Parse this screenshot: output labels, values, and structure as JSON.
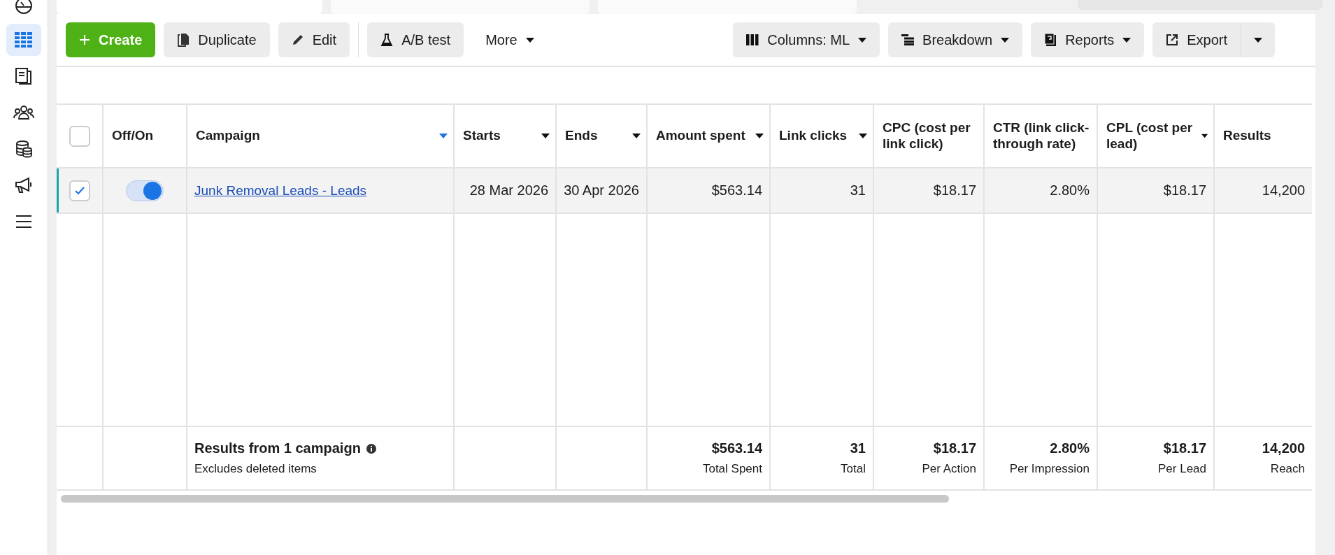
{
  "sidebar": {
    "items": [
      {
        "selected": false
      },
      {
        "selected": true
      },
      {
        "selected": false
      },
      {
        "selected": false
      },
      {
        "selected": false
      },
      {
        "selected": false
      },
      {
        "selected": false
      }
    ]
  },
  "toolbar": {
    "left": [
      {
        "label": "Create",
        "kind": "primary",
        "dropdown": false
      },
      {
        "label": "Duplicate",
        "kind": "secondary",
        "dropdown": false
      },
      {
        "label": "Edit",
        "kind": "secondary",
        "dropdown": false
      },
      {
        "label": "A/B test",
        "kind": "secondary",
        "dropdown": false
      },
      {
        "label": "More",
        "kind": "plain",
        "dropdown": true
      }
    ],
    "right": [
      {
        "label": "Columns: ML",
        "kind": "secondary",
        "dropdown": true
      },
      {
        "label": "Breakdown",
        "kind": "secondary",
        "dropdown": true
      },
      {
        "label": "Reports",
        "kind": "secondary",
        "dropdown": true
      },
      {
        "label": "Export",
        "kind": "split",
        "dropdown": true
      }
    ]
  },
  "table": {
    "header_checked": false,
    "fixed_columns": [
      {
        "label": "Off/On",
        "menu": false,
        "sorted": false
      },
      {
        "label": "Campaign",
        "menu": true,
        "sorted": true
      }
    ],
    "columns": [
      {
        "label": "Starts",
        "menu": true,
        "sorted": false
      },
      {
        "label": "Ends",
        "menu": true,
        "sorted": false
      },
      {
        "label": "Amount spent",
        "menu": true,
        "sorted": false
      },
      {
        "label": "Link clicks",
        "menu": true,
        "sorted": false
      },
      {
        "label": "CPC (cost per link click)",
        "menu": false,
        "sorted": false
      },
      {
        "label": "CTR (link click-through rate)",
        "menu": false,
        "sorted": false
      },
      {
        "label": "CPL (cost per lead)",
        "menu": true,
        "sorted": false
      },
      {
        "label": "Results",
        "menu": false,
        "sorted": false
      }
    ],
    "rows": [
      {
        "selected": true,
        "checked": true,
        "on": true,
        "campaign": "Junk Removal Leads - Leads",
        "cells": [
          "28 Mar 2026",
          "30 Apr 2026",
          "$563.14",
          "31",
          "$18.17",
          "2.80%",
          "$18.17",
          "14,200"
        ]
      }
    ],
    "footer": {
      "title": "Results from 1 campaign",
      "note": "Excludes deleted items",
      "cells": [
        null,
        null,
        {
          "value": "$563.14",
          "caption": "Total Spent"
        },
        {
          "value": "31",
          "caption": "Total"
        },
        {
          "value": "$18.17",
          "caption": "Per Action"
        },
        {
          "value": "2.80%",
          "caption": "Per Impression"
        },
        {
          "value": "$18.17",
          "caption": "Per Lead"
        },
        {
          "value": "14,200",
          "caption": "Reach"
        }
      ]
    }
  }
}
